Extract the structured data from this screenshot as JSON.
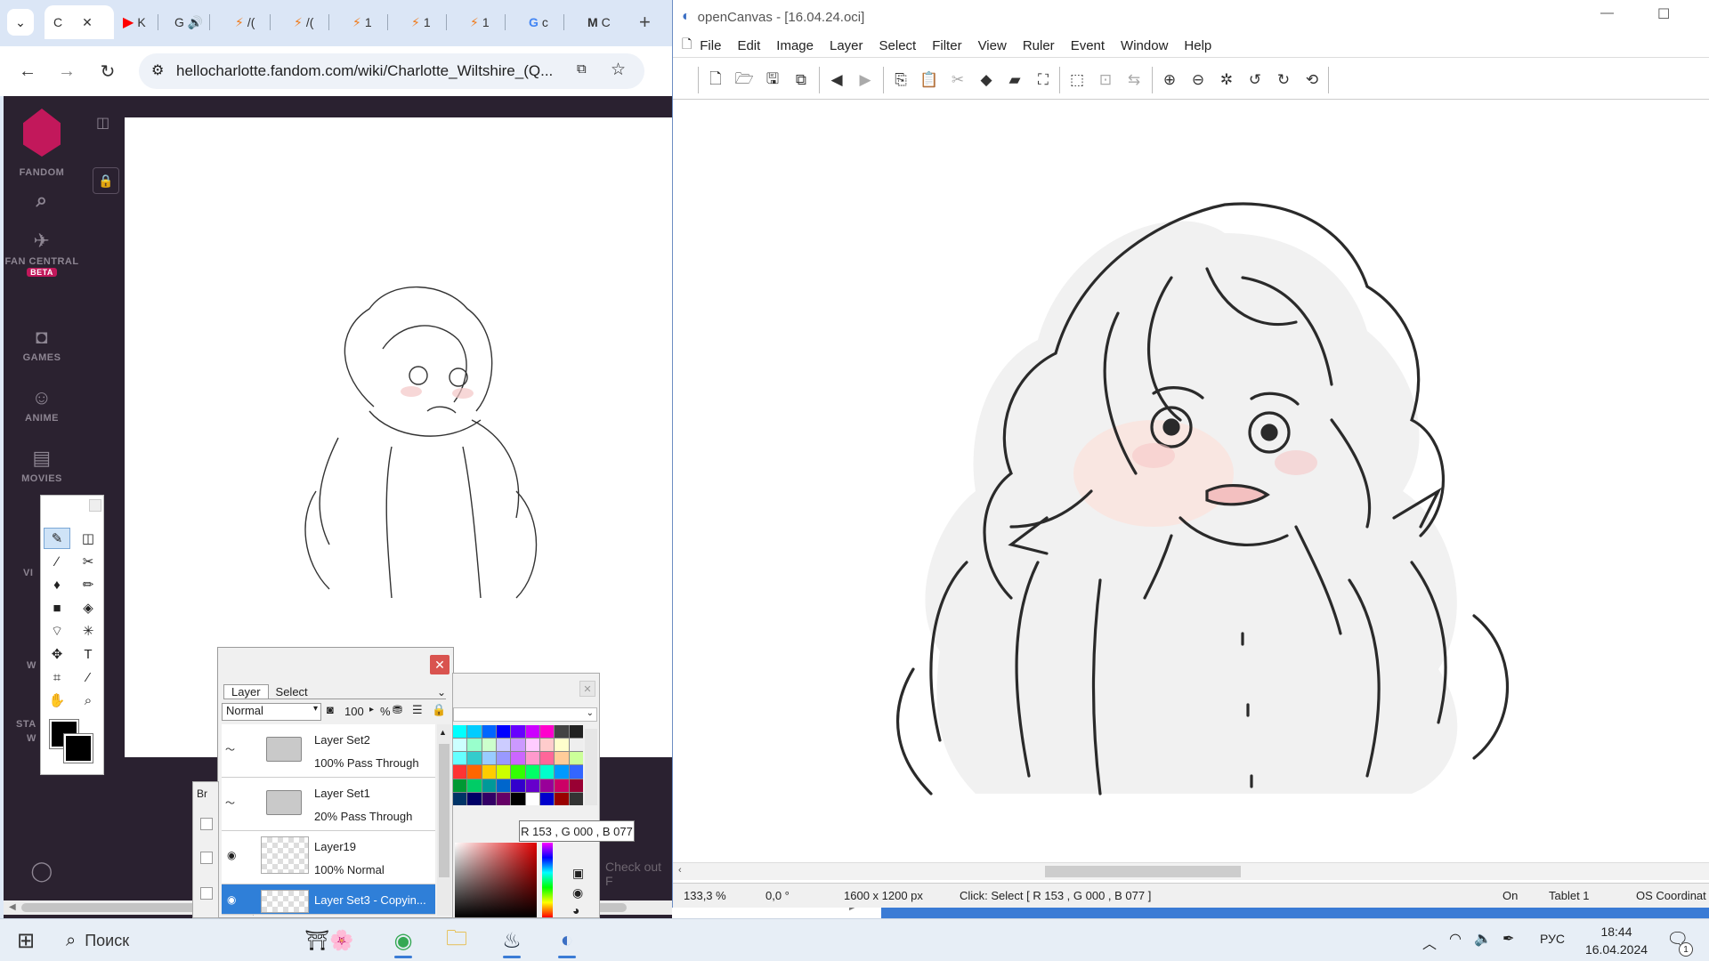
{
  "browser": {
    "tabs": [
      {
        "label": "C",
        "active": true
      },
      {
        "label": "K",
        "icon": "youtube-icon"
      },
      {
        "label": "G",
        "icon": "speaker-icon"
      },
      {
        "label": "/(",
        "icon": "bolt-icon"
      },
      {
        "label": "/(",
        "icon": "bolt-icon"
      },
      {
        "label": "1",
        "icon": "bolt-icon"
      },
      {
        "label": "1",
        "icon": "bolt-icon"
      },
      {
        "label": "1",
        "icon": "bolt-icon"
      },
      {
        "label": "c",
        "icon": "google-icon"
      },
      {
        "label": "C",
        "icon": "gmail-icon"
      }
    ],
    "url": "hellocharlotte.fandom.com/wiki/Charlotte_Wiltshire_(Q...",
    "new_tab": "+",
    "fandom": {
      "logo_label": "FANDOM",
      "nav": [
        {
          "label": "FAN CENTRAL",
          "badge": "BETA"
        },
        {
          "label": "GAMES"
        },
        {
          "label": "ANIME"
        },
        {
          "label": "MOVIES"
        },
        {
          "label": "VI"
        },
        {
          "label": "W"
        },
        {
          "label": "STA"
        },
        {
          "label": "W"
        }
      ],
      "check_out": "Check out F"
    }
  },
  "layer_panel": {
    "tabs": [
      "Layer",
      "Select"
    ],
    "blend_mode": "Normal",
    "opacity": "100",
    "opacity_unit": "%",
    "layers": [
      {
        "name": "Layer Set2",
        "mode": "100% Pass Through",
        "type": "folder"
      },
      {
        "name": "Layer Set1",
        "mode": "20% Pass Through",
        "type": "folder"
      },
      {
        "name": "Layer19",
        "mode": "100% Normal",
        "type": "layer"
      },
      {
        "name": "Layer Set3 - Copyin...",
        "mode": "",
        "type": "layer",
        "selected": true
      }
    ],
    "brush_tab_label": "Br"
  },
  "color_tooltip": "R 153 , G 000 , B 077",
  "opencanvas": {
    "title": "openCanvas - [16.04.24.oci]",
    "menu": [
      "File",
      "Edit",
      "Image",
      "Layer",
      "Select",
      "Filter",
      "View",
      "Ruler",
      "Event",
      "Window",
      "Help"
    ],
    "status": {
      "zoom": "133,3 %",
      "rotation": "0,0 °",
      "size": "1600 x 1200 px",
      "message": "Click: Select [ R 153 , G 000 , B 077 ]",
      "toggle": "On",
      "tablet": "Tablet 1",
      "coords": "OS Coordinat"
    }
  },
  "taskbar": {
    "search_placeholder": "Поиск",
    "lang": "РУС",
    "time": "18:44",
    "date": "16.04.2024",
    "notif_count": "1"
  },
  "colors": {
    "accent": "#3a7bd5",
    "fandom_bg": "#2a2130",
    "layer_selected": "#2f7fd8",
    "close_red": "#d9534f"
  }
}
